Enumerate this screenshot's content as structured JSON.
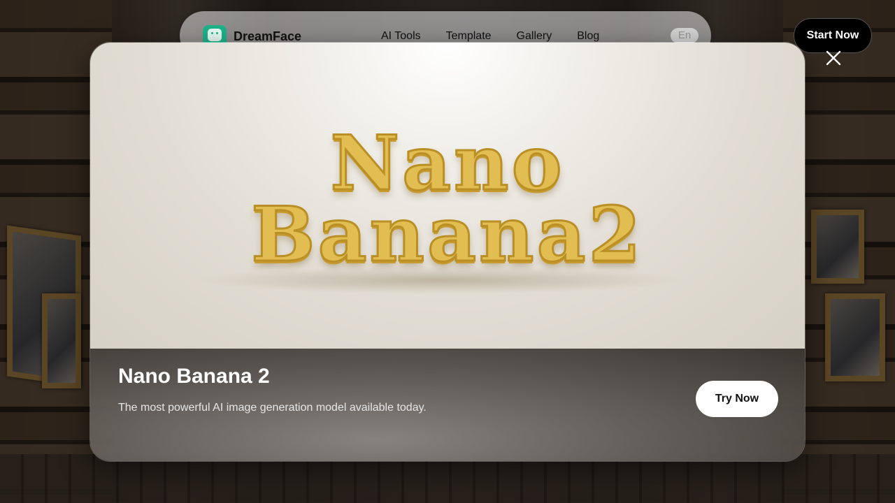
{
  "header": {
    "brand": "DreamFace",
    "nav": [
      "AI Tools",
      "Template",
      "Gallery",
      "Blog"
    ],
    "language": "En",
    "start_button": "Start Now"
  },
  "modal": {
    "hero_line1": "Nano",
    "hero_line2": "Banana2",
    "title": "Nano Banana 2",
    "subtitle": "The most powerful AI image generation model available today.",
    "cta": "Try Now",
    "close_icon": "close-icon"
  }
}
